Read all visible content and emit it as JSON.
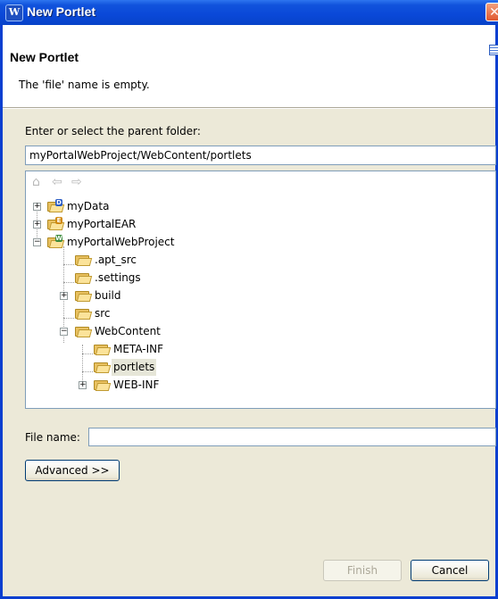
{
  "window": {
    "title": "New Portlet",
    "close_glyph": "✕"
  },
  "header": {
    "title": "New Portlet",
    "message": "The 'file' name is empty."
  },
  "parent_folder": {
    "label": "Enter or select the parent folder:",
    "value": "myPortalWebProject/WebContent/portlets"
  },
  "tree": {
    "items": [
      {
        "label": "myData",
        "expander": "+"
      },
      {
        "label": "myPortalEAR",
        "expander": "+"
      },
      {
        "label": "myPortalWebProject",
        "expander": "−"
      },
      {
        "label": ".apt_src"
      },
      {
        "label": ".settings"
      },
      {
        "label": "build",
        "expander": "+"
      },
      {
        "label": "src"
      },
      {
        "label": "WebContent",
        "expander": "−"
      },
      {
        "label": "META-INF"
      },
      {
        "label": "portlets",
        "selected": true
      },
      {
        "label": "WEB-INF",
        "expander": "+"
      }
    ]
  },
  "file_name": {
    "label": "File name:",
    "value": ""
  },
  "buttons": {
    "advanced": "Advanced >>",
    "finish": "Finish",
    "cancel": "Cancel"
  },
  "icons": {
    "home": "⌂",
    "back": "⇦",
    "forward": "⇨"
  }
}
